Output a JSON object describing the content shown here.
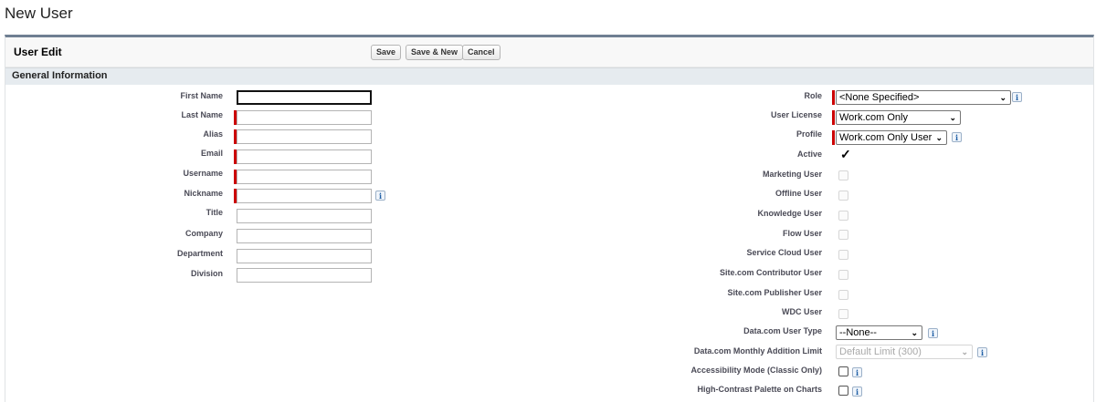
{
  "page": {
    "title": "New User"
  },
  "panel": {
    "title": "User Edit",
    "buttons": {
      "save": "Save",
      "save_new": "Save & New",
      "cancel": "Cancel"
    }
  },
  "section": {
    "title": "General Information"
  },
  "left_fields": {
    "first_name": {
      "label": "First Name",
      "value": ""
    },
    "last_name": {
      "label": "Last Name",
      "value": ""
    },
    "alias": {
      "label": "Alias",
      "value": ""
    },
    "email": {
      "label": "Email",
      "value": ""
    },
    "username": {
      "label": "Username",
      "value": ""
    },
    "nickname": {
      "label": "Nickname",
      "value": ""
    },
    "title": {
      "label": "Title",
      "value": ""
    },
    "company": {
      "label": "Company",
      "value": ""
    },
    "department": {
      "label": "Department",
      "value": ""
    },
    "division": {
      "label": "Division",
      "value": ""
    }
  },
  "right_fields": {
    "role": {
      "label": "Role",
      "value": "<None Specified>"
    },
    "user_license": {
      "label": "User License",
      "value": "Work.com Only"
    },
    "profile": {
      "label": "Profile",
      "value": "Work.com Only User"
    },
    "active": {
      "label": "Active",
      "checked": true
    },
    "marketing_user": {
      "label": "Marketing User",
      "checked": false
    },
    "offline_user": {
      "label": "Offline User",
      "checked": false
    },
    "knowledge_user": {
      "label": "Knowledge User",
      "checked": false
    },
    "flow_user": {
      "label": "Flow User",
      "checked": false
    },
    "service_cloud_user": {
      "label": "Service Cloud User",
      "checked": false
    },
    "site_contributor_user": {
      "label": "Site.com Contributor User",
      "checked": false
    },
    "site_publisher_user": {
      "label": "Site.com Publisher User",
      "checked": false
    },
    "wdc_user": {
      "label": "WDC User",
      "checked": false
    },
    "data_user_type": {
      "label": "Data.com User Type",
      "value": "--None--"
    },
    "data_monthly_limit": {
      "label": "Data.com Monthly Addition Limit",
      "value": "Default Limit (300)"
    },
    "accessibility_mode": {
      "label": "Accessibility Mode (Classic Only)",
      "checked": false
    },
    "high_contrast": {
      "label": "High-Contrast Palette on Charts",
      "checked": false
    }
  },
  "icons": {
    "info": "info-icon",
    "checkmark": "checkmark-icon",
    "dropdown": "chevron-down-icon"
  },
  "glyphs": {
    "info": "i",
    "check": "✓",
    "arrow": "⌄"
  },
  "colors": {
    "required": "#cc0000",
    "header_border": "#6f7f92",
    "section_bg": "#e6ebef"
  }
}
